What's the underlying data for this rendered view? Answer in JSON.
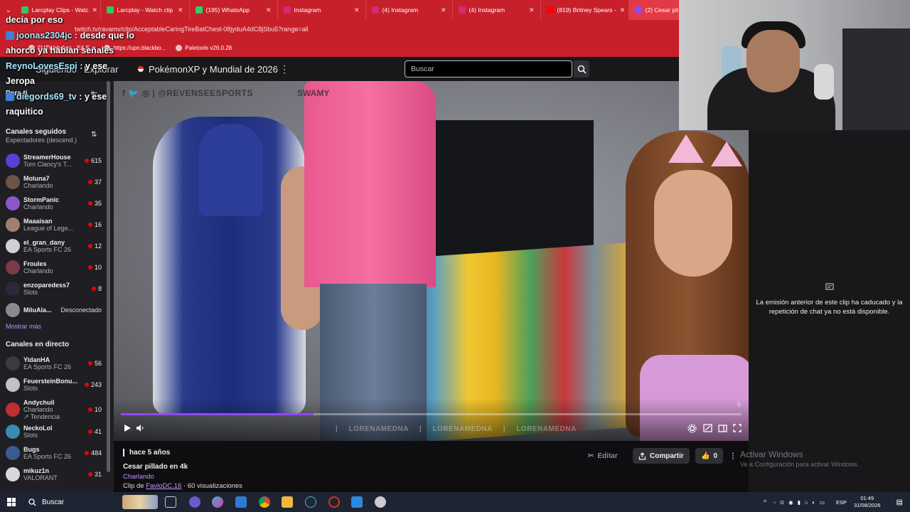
{
  "browser": {
    "tabs": [
      {
        "label": "Larcplay Clips - Watc",
        "color": "#34c759",
        "active": false
      },
      {
        "label": "Larcplay - Watch clip",
        "color": "#34c759",
        "active": false
      },
      {
        "label": "(195) WhatsApp",
        "color": "#25d366",
        "active": false
      },
      {
        "label": "Instagram",
        "color": "#d62976",
        "active": false
      },
      {
        "label": "(4) Instagram",
        "color": "#d62976",
        "active": false
      },
      {
        "label": "(4) Instagram",
        "color": "#d62976",
        "active": false
      },
      {
        "label": "(819) Britney Spears -",
        "color": "#ff0000",
        "active": false
      },
      {
        "label": "(2) Cesar pil",
        "color": "#9147ff",
        "active": true
      }
    ],
    "url": "twitch.tv/ravamv/clip/AcceptableCaringTireBatChest-08jyduA4dC8jSbu5?range=all",
    "bookmarks": [
      "FUTWeb App - EA S...",
      "https://upn.blackbo...",
      "Paletools v26.0.28"
    ]
  },
  "chat_overlay": [
    {
      "user": "",
      "text": "decía por eso"
    },
    {
      "user": "joonas2304jc",
      "text": ": desde que lo ahorco ya habían señales"
    },
    {
      "user": "ReynoLovesEspi",
      "text": ": y ese Jeropa"
    },
    {
      "user": "diegords69_tv",
      "text": ": y ese raquitico"
    }
  ],
  "topnav": {
    "following": "Siguiendo",
    "explore": "Explorar",
    "event": "PokémonXP y Mundial de 2026",
    "search_placeholder": "Buscar"
  },
  "sidebar": {
    "for_you": "Para ti",
    "followed_header": "Canales seguidos",
    "followed_sort": "Espectadores (descend.)",
    "followed": [
      {
        "name": "StreamerHouse",
        "game": "Tom Clancy's T...",
        "viewers": "615",
        "color": "#5b3fd4"
      },
      {
        "name": "Moluna7",
        "game": "Charlando",
        "viewers": "37",
        "color": "#6b5544"
      },
      {
        "name": "StormPanic",
        "game": "Charlando",
        "viewers": "35",
        "color": "#8a56c9"
      },
      {
        "name": "Maaaisan",
        "game": "League of Lege...",
        "viewers": "16",
        "color": "#a08070"
      },
      {
        "name": "el_gran_dany",
        "game": "EA Sports FC 26",
        "viewers": "12",
        "color": "#d0d0d8"
      },
      {
        "name": "Froules",
        "game": "Charlando",
        "viewers": "10",
        "color": "#7a3a4a"
      },
      {
        "name": "enzoparedess7",
        "game": "Slots",
        "viewers": "8",
        "color": "#2a2a3a"
      },
      {
        "name": "MiluAla...",
        "game": "",
        "viewers": "",
        "offline": "Desconectado",
        "color": "#8a8a90"
      }
    ],
    "show_more": "Mostrar más",
    "live_header": "Canales en directo",
    "live": [
      {
        "name": "YidanHA",
        "game": "EA Sports FC 26",
        "viewers": "56",
        "color": "#3a3a42"
      },
      {
        "name": "FeuersteinBonu...",
        "game": "Slots",
        "viewers": "243",
        "color": "#c0c0c8"
      },
      {
        "name": "Andychuil",
        "game": "Charlando",
        "tag": "↗ Tendencia",
        "viewers": "10",
        "color": "#c03030"
      },
      {
        "name": "NeckoLol",
        "game": "Slots",
        "viewers": "41",
        "color": "#3a8ab0"
      },
      {
        "name": "Bugs",
        "game": "EA Sports FC 26",
        "viewers": "484",
        "color": "#3a5a90"
      },
      {
        "name": "mikuz1n",
        "game": "VALORANT",
        "viewers": "31",
        "color": "#d8d8e0"
      }
    ]
  },
  "video": {
    "watermark_top": "f 🐦 ◎ | @REVENSEESPORTS",
    "watermark_brand": "SWAMY",
    "watermark_bottom": "| LORENAMEDNA  | LORENAMEDNA  | LORENAMEDNA",
    "progress_pct": 31,
    "time_label": "9"
  },
  "clip": {
    "ago": "hace 5 años",
    "title": "Cesar pillado en 4k",
    "category": "Charlando",
    "by_prefix": "Clip de ",
    "by_user": "FavloDC.16",
    "views": " · 60 visualizaciones",
    "edit_label": "Editar",
    "share_label": "Compartir",
    "like_count": "0"
  },
  "chat_panel": {
    "message": "La emisión anterior de este clip ha caducado y la repetición de chat ya no está disponible."
  },
  "activate_windows": {
    "title": "Activar Windows",
    "subtitle": "Ve a Configuración para activar Windows."
  },
  "taskbar": {
    "search": "Buscar",
    "lang": "ESP",
    "time": "01:49",
    "date": "31/08/2026"
  }
}
